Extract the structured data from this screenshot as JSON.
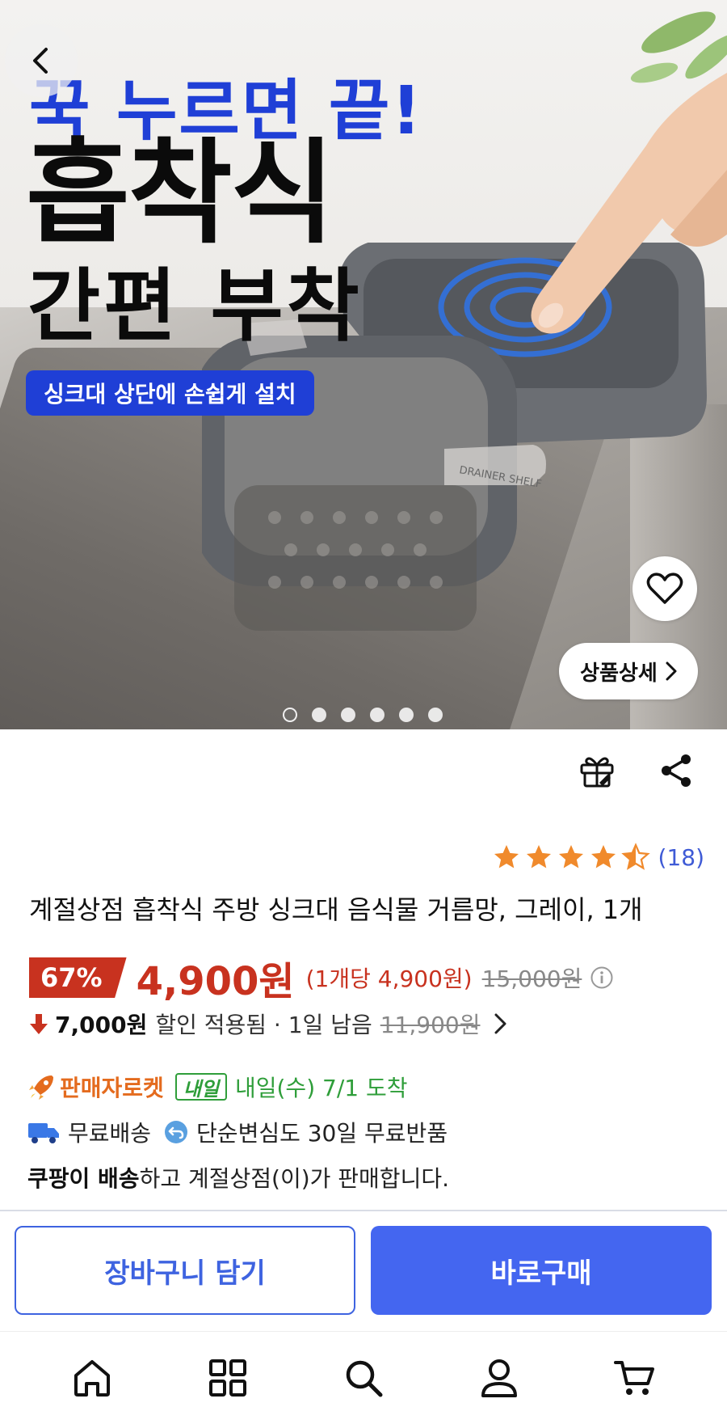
{
  "hero": {
    "headline_line1": "꾹 누르면 끝!",
    "headline_line2": "흡착식",
    "headline_line3": "간편 부착",
    "badge": "싱크대 상단에 손쉽게 설치",
    "product_engraving": "DRAINER SHELF",
    "detail_button_label": "상품상세",
    "detail_button_icon": "chevron-right-icon",
    "back_icon": "chevron-left-icon",
    "wish_icon": "heart-icon",
    "slide_count": 6,
    "active_slide_index": 0
  },
  "actions": {
    "gift_icon": "gift-icon",
    "share_icon": "share-icon"
  },
  "product": {
    "rating": 4.5,
    "rating_max": 5,
    "review_count": "(18)",
    "title": "계절상점 흡착식 주방 싱크대 음식물 거름망, 그레이, 1개",
    "discount_badge": "67%",
    "price": "4,900원",
    "unit_price": "(1개당 4,900원)",
    "original_price": "15,000원",
    "coupon": {
      "amount": "7,000원",
      "text": "할인 적용됨 · 1일 남음",
      "strike_price": "11,900원"
    },
    "delivery": {
      "seller_rocket": "판매자로켓",
      "tomorrow_badge": "내일",
      "arrival": "내일(수) 7/1 도착",
      "free_shipping": "무료배송",
      "free_return": "단순변심도 30일 무료반품",
      "seller_strong": "쿠팡이 배송",
      "seller_rest": "하고 계절상점(이)가 판매합니다."
    }
  },
  "buttons": {
    "add_to_cart": "장바구니 담기",
    "buy_now": "바로구매"
  },
  "bottom_nav": {
    "items": [
      "home-icon",
      "category-icon",
      "search-icon",
      "my-page-icon",
      "cart-icon"
    ]
  },
  "colors": {
    "accent_blue": "#4466f0",
    "price_red": "#c8321f",
    "rating_star": "#f08a2c",
    "delivery_green": "#2f9e3a",
    "rocket_orange": "#e46b1e"
  }
}
